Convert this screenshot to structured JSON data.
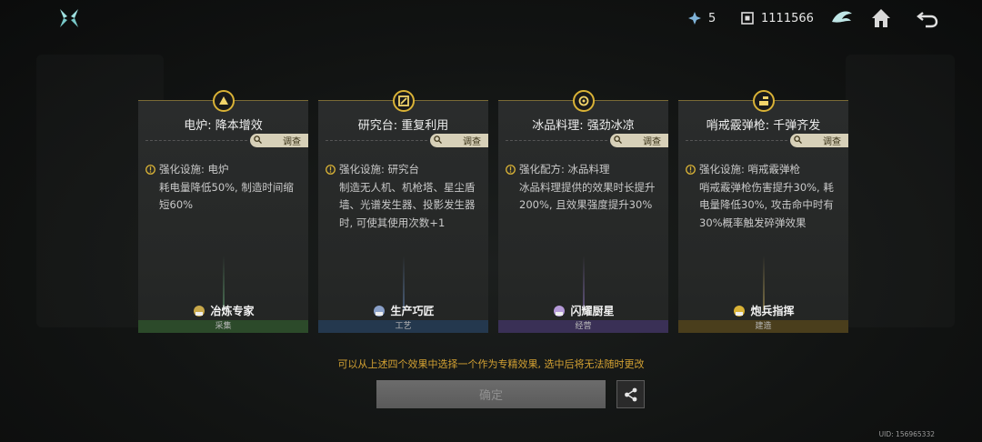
{
  "topbar": {
    "stars": "5",
    "currency": "1111566"
  },
  "cards": [
    {
      "title": "电炉: 降本增效",
      "investigate": "调查",
      "desc_head": "强化设施: 电炉",
      "desc_body": "耗电量降低50%, 制造时间缩短60%",
      "role": "冶炼专家",
      "category": "采集",
      "cat_color": "#2c4a2a"
    },
    {
      "title": "研究台: 重复利用",
      "investigate": "调查",
      "desc_head": "强化设施: 研究台",
      "desc_body": "制造无人机、机枪塔、星尘盾墙、光谱发生器、投影发生器时, 可使其使用次数+1",
      "role": "生产巧匠",
      "category": "工艺",
      "cat_color": "#24384e"
    },
    {
      "title": "冰品料理: 强劲冰凉",
      "investigate": "调查",
      "desc_head": "强化配方: 冰品料理",
      "desc_body": "冰品料理提供的效果时长提升200%, 且效果强度提升30%",
      "role": "闪耀厨星",
      "category": "经营",
      "cat_color": "#3a3056"
    },
    {
      "title": "哨戒霰弹枪: 千弹齐发",
      "investigate": "调查",
      "desc_head": "强化设施: 哨戒霰弹枪",
      "desc_body": "哨戒霰弹枪伤害提升30%, 耗电量降低30%, 攻击命中时有30%概率触发碎弹效果",
      "role": "炮兵指挥",
      "category": "建造",
      "cat_color": "#4a3e1c"
    }
  ],
  "hint": "可以从上述四个效果中选择一个作为专精效果, 选中后将无法随时更改",
  "confirm_label": "确定",
  "uid": "UID: 156965332",
  "colors": {
    "accent_gold": "#d9b236",
    "hint": "#d2a032"
  }
}
